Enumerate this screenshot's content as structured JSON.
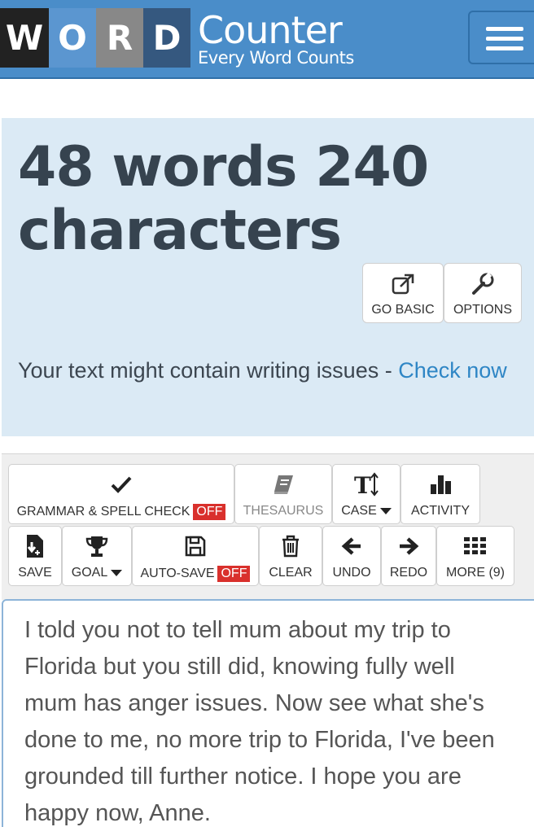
{
  "header": {
    "logo_letters": [
      "W",
      "O",
      "R",
      "D"
    ],
    "brand_name": "Counter",
    "tagline": "Every Word Counts",
    "menu_icon": "hamburger-icon",
    "colors": {
      "bar": "#4a8dc9",
      "tile_w": "#222222",
      "tile_o": "#5b96d0",
      "tile_r": "#888888",
      "tile_d": "#35587f"
    }
  },
  "counter": {
    "summary": "48 words 240 characters",
    "go_basic": {
      "label": "GO BASIC",
      "icon": "external-link-icon"
    },
    "options": {
      "label": "OPTIONS",
      "icon": "wrench-icon"
    },
    "issues_text": "Your text might contain writing issues - ",
    "issues_link": "Check now"
  },
  "toolbar": {
    "grammar": {
      "label": "GRAMMAR & SPELL CHECK",
      "state": "OFF",
      "icon": "checkmark-icon"
    },
    "thesaurus": {
      "label": "THESAURUS",
      "icon": "book-icon"
    },
    "case": {
      "label": "CASE",
      "icon": "text-case-icon"
    },
    "activity": {
      "label": "ACTIVITY",
      "icon": "bar-chart-icon"
    },
    "save": {
      "label": "SAVE",
      "icon": "save-file-icon"
    },
    "goal": {
      "label": "GOAL",
      "icon": "trophy-icon"
    },
    "autosave": {
      "label": "AUTO-SAVE",
      "state": "OFF",
      "icon": "floppy-icon"
    },
    "clear": {
      "label": "CLEAR",
      "icon": "trash-icon"
    },
    "undo": {
      "label": "UNDO",
      "icon": "arrow-left-icon"
    },
    "redo": {
      "label": "REDO",
      "icon": "arrow-right-icon"
    },
    "more": {
      "label": "MORE (9)",
      "icon": "grid-icon"
    },
    "off_color": "#d9302c"
  },
  "editor": {
    "text": "I told you not to tell mum about my trip to Florida but you still did, knowing fully well mum has anger issues. Now see what she's done to me, no more trip to Florida, I've been grounded till further notice. I hope you are happy now, Anne."
  }
}
